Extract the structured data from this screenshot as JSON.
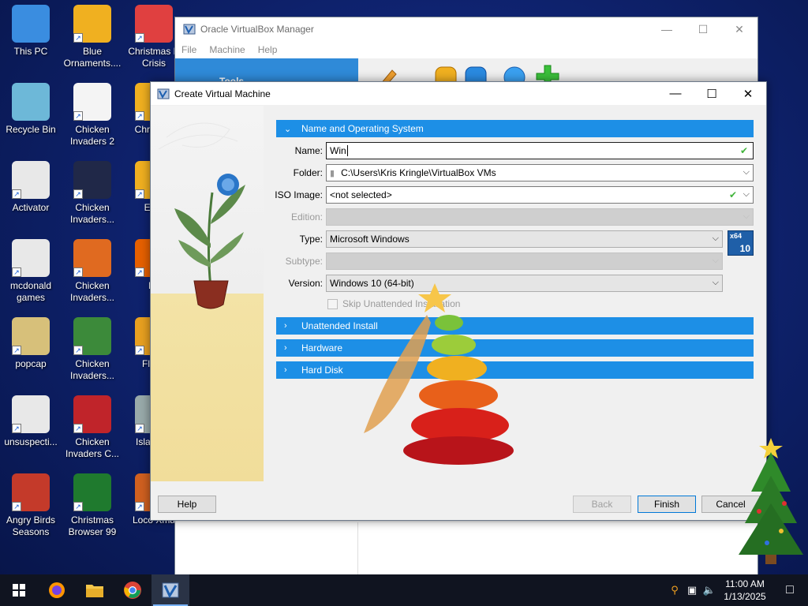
{
  "desktop_icons": [
    {
      "id": "this-pc",
      "label": "This PC",
      "col": 0,
      "row": 0,
      "color": "#3a8de0"
    },
    {
      "id": "recycle-bin",
      "label": "Recycle Bin",
      "col": 0,
      "row": 1,
      "color": "#6db8d8"
    },
    {
      "id": "activator",
      "label": "Activator",
      "col": 0,
      "row": 2,
      "color": "#e8e8e8"
    },
    {
      "id": "mcdonald-games",
      "label": "mcdonald games",
      "col": 0,
      "row": 3,
      "color": "#e8e8e8"
    },
    {
      "id": "popcap",
      "label": "popcap",
      "col": 0,
      "row": 4,
      "color": "#d7c07a"
    },
    {
      "id": "unsuspecti",
      "label": "unsuspecti...",
      "col": 0,
      "row": 5,
      "color": "#e8e8e8"
    },
    {
      "id": "angry-birds-seasons",
      "label": "Angry Birds Seasons",
      "col": 0,
      "row": 6,
      "color": "#c43a2a"
    },
    {
      "id": "blue-ornaments",
      "label": "Blue Ornaments....",
      "col": 1,
      "row": 0,
      "color": "#f0b020"
    },
    {
      "id": "chicken-invaders-2",
      "label": "Chicken Invaders 2",
      "col": 1,
      "row": 1,
      "color": "#f4f4f4"
    },
    {
      "id": "chicken-invaders-3",
      "label": "Chicken Invaders...",
      "col": 1,
      "row": 2,
      "color": "#202848"
    },
    {
      "id": "chicken-invaders-4",
      "label": "Chicken Invaders...",
      "col": 1,
      "row": 3,
      "color": "#e06a20"
    },
    {
      "id": "chicken-invaders-5",
      "label": "Chicken Invaders...",
      "col": 1,
      "row": 4,
      "color": "#3c8a3a"
    },
    {
      "id": "chicken-invaders-c",
      "label": "Chicken Invaders C...",
      "col": 1,
      "row": 5,
      "color": "#c0242a"
    },
    {
      "id": "christmas-browser-99",
      "label": "Christmas Browser 99",
      "col": 1,
      "row": 6,
      "color": "#1f7a2e"
    },
    {
      "id": "christmas-crisis",
      "label": "Christmas E Crisis",
      "col": 2,
      "row": 0,
      "color": "#e04040"
    },
    {
      "id": "chri-swe",
      "label": "Chri Swe",
      "col": 2,
      "row": 1,
      "color": "#f0b020"
    },
    {
      "id": "ever",
      "label": "Ever",
      "col": 2,
      "row": 2,
      "color": "#f0b020"
    },
    {
      "id": "fir",
      "label": "Fir",
      "col": 2,
      "row": 3,
      "color": "#e66000"
    },
    {
      "id": "flapp",
      "label": "Flapp",
      "col": 2,
      "row": 4,
      "color": "#e8a020"
    },
    {
      "id": "island-x",
      "label": "Island Xi",
      "col": 2,
      "row": 5,
      "color": "#9aa"
    },
    {
      "id": "loco-xmas",
      "label": "Loco Xma",
      "col": 2,
      "row": 6,
      "color": "#d06020"
    }
  ],
  "vbox_manager": {
    "title": "Oracle VirtualBox Manager",
    "menu": [
      "File",
      "Machine",
      "Help"
    ],
    "tools_label": "Tools"
  },
  "dialog": {
    "title": "Create Virtual Machine",
    "sections": {
      "name_os": "Name and Operating System",
      "unattended": "Unattended Install",
      "hardware": "Hardware",
      "hard_disk": "Hard Disk"
    },
    "labels": {
      "name": "Name:",
      "folder": "Folder:",
      "iso": "ISO Image:",
      "edition": "Edition:",
      "type": "Type:",
      "subtype": "Subtype:",
      "version": "Version:"
    },
    "values": {
      "name": "Win",
      "folder": "C:\\Users\\Kris Kringle\\VirtualBox VMs",
      "iso": "<not selected>",
      "edition": "",
      "type": "Microsoft Windows",
      "subtype": "",
      "version": "Windows 10 (64-bit)"
    },
    "os_badge": {
      "arch": "x64",
      "ver": "10"
    },
    "skip_unattended": "Skip Unattended Installation",
    "buttons": {
      "help": "Help",
      "back": "Back",
      "finish": "Finish",
      "cancel": "Cancel"
    }
  },
  "taskbar": {
    "time": "11:00 AM",
    "date": "1/13/2025"
  },
  "colors": {
    "section_blue": "#1d8fe6",
    "desktop_blue": "#0f2370",
    "check_green": "#41b43b"
  }
}
